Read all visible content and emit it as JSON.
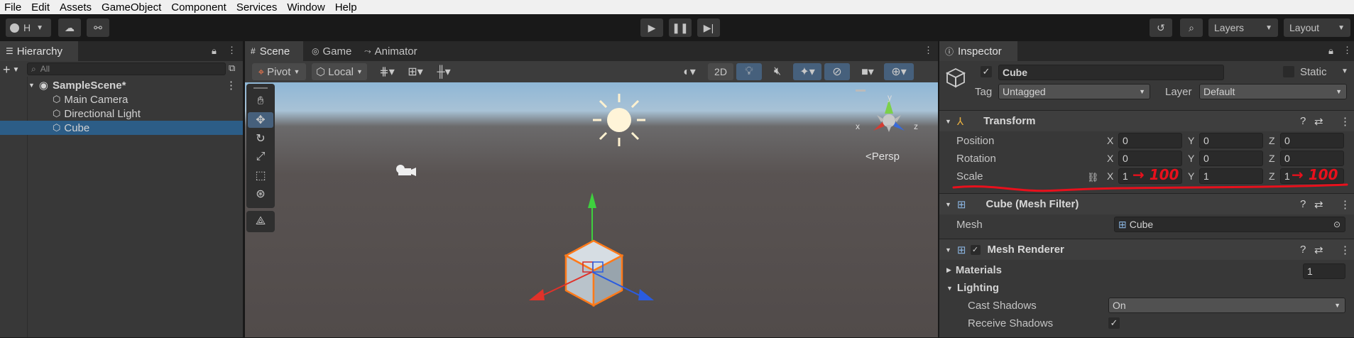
{
  "menu": [
    "File",
    "Edit",
    "Assets",
    "GameObject",
    "Component",
    "Services",
    "Window",
    "Help"
  ],
  "toolbar": {
    "account": "H",
    "layers": "Layers",
    "layout": "Layout"
  },
  "hierarchy": {
    "title": "Hierarchy",
    "search_placeholder": "All",
    "scene": "SampleScene*",
    "items": [
      "Main Camera",
      "Directional Light",
      "Cube"
    ]
  },
  "scene_tabs": {
    "scene": "Scene",
    "game": "Game",
    "animator": "Animator"
  },
  "scene_toolbar": {
    "pivot": "Pivot",
    "local": "Local",
    "mode_2d": "2D"
  },
  "scene_view": {
    "persp": "<Persp",
    "gizmo_y": "y",
    "gizmo_x": "x",
    "gizmo_z": "z"
  },
  "inspector": {
    "title": "Inspector",
    "object_name": "Cube",
    "static": "Static",
    "tag_label": "Tag",
    "tag": "Untagged",
    "layer_label": "Layer",
    "layer": "Default",
    "transform": {
      "title": "Transform",
      "position_label": "Position",
      "rotation_label": "Rotation",
      "scale_label": "Scale",
      "axis_x": "X",
      "axis_y": "Y",
      "axis_z": "Z",
      "position": [
        "0",
        "0",
        "0"
      ],
      "rotation": [
        "0",
        "0",
        "0"
      ],
      "scale": [
        "1",
        "1",
        "1"
      ]
    },
    "annotations": {
      "x_note": "→ 100",
      "z_note": "→ 100",
      "color": "#e8101c"
    },
    "mesh_filter": {
      "title": "Cube (Mesh Filter)",
      "mesh_label": "Mesh",
      "mesh": "Cube"
    },
    "mesh_renderer": {
      "title": "Mesh Renderer",
      "materials_label": "Materials",
      "materials_count": "1",
      "lighting_label": "Lighting",
      "cast_shadows_label": "Cast Shadows",
      "cast_shadows": "On",
      "receive_shadows_label": "Receive Shadows"
    }
  }
}
